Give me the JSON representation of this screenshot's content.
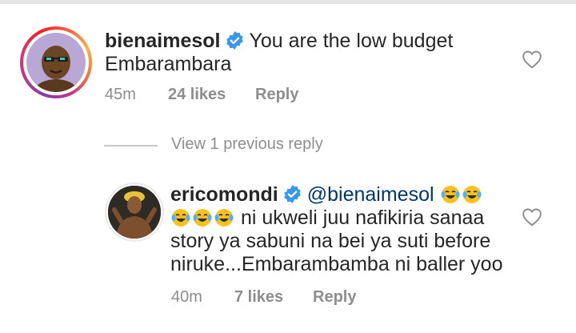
{
  "comments": [
    {
      "username": "bienaimesol",
      "verified": true,
      "text_line1": "You are the low budget",
      "text_line2": "Embarambara",
      "time": "45m",
      "likes": "24 likes",
      "reply_label": "Reply",
      "avatar_icon": "avatar-cartoon-sunglasses",
      "heart_icon": "heart-outline-icon"
    },
    {
      "username": "ericomondi",
      "verified": true,
      "mention": "@bienaimesol",
      "text_line2": "ni ukweli juu nafikiria sanaa",
      "text_line3": "story ya sabuni na bei ya suti before",
      "text_line4": "niruke...Embarambamba ni baller yoo",
      "time": "40m",
      "likes": "7 likes",
      "reply_label": "Reply",
      "avatar_icon": "avatar-photo-person",
      "heart_icon": "heart-outline-icon"
    }
  ],
  "view_previous_label": "View 1 previous reply",
  "colors": {
    "verified": "#3897f0",
    "mention": "#00376b",
    "meta": "#8e8e8e",
    "text": "#262626"
  }
}
